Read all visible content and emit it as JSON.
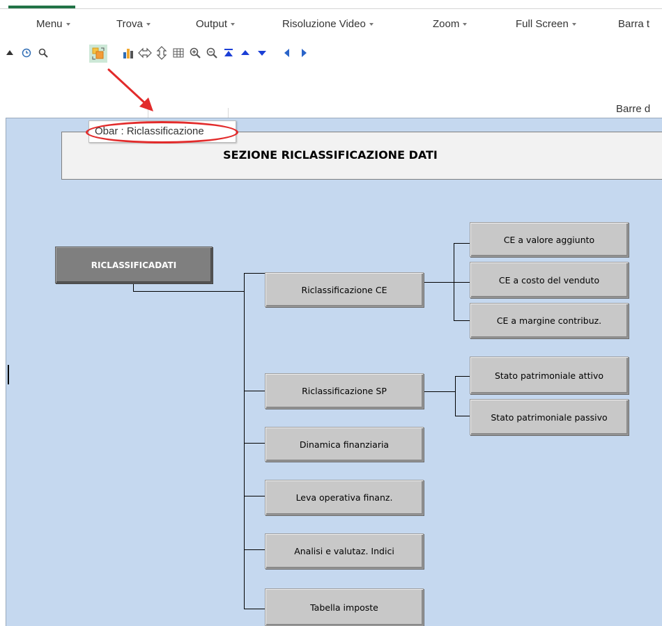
{
  "ribbon": {
    "menus": [
      {
        "label": "Menu"
      },
      {
        "label": "Trova"
      },
      {
        "label": "Output"
      },
      {
        "label": "Risoluzione Video"
      },
      {
        "label": "Zoom"
      },
      {
        "label": "Full Screen"
      },
      {
        "label": "Barra t"
      }
    ],
    "toolbar_icons": [
      "triangle-up-icon",
      "clock-icon",
      "magnifier-icon",
      "objects-icon",
      "bar-chart-icon",
      "expand-horizontal-icon",
      "expand-vertical-icon",
      "table-icon",
      "zoom-in-icon",
      "zoom-out-icon",
      "go-to-top-icon",
      "arrow-up-icon",
      "arrow-down-icon",
      "arrow-left-icon",
      "arrow-right-icon"
    ],
    "group_label": "Barre d"
  },
  "tooltip": {
    "text": "Obar : Riclassificazione"
  },
  "annotation": {
    "color": "#e22b2b"
  },
  "sheet": {
    "section_title": "SEZIONE RICLASSIFICAZIONE DATI",
    "main_button": "RICLASSIFICADATI",
    "level1": [
      {
        "label": "Riclassificazione CE"
      },
      {
        "label": "Riclassificazione SP"
      },
      {
        "label": "Dinamica finanziaria"
      },
      {
        "label": "Leva operativa  finanz."
      },
      {
        "label": "Analisi e valutaz. Indici"
      },
      {
        "label": "Tabella imposte"
      }
    ],
    "ce_children": [
      {
        "label": "CE  a valore aggiunto"
      },
      {
        "label": "CE  a costo del venduto"
      },
      {
        "label": "CE a margine contribuz."
      }
    ],
    "sp_children": [
      {
        "label": "Stato patrimoniale attivo"
      },
      {
        "label": "Stato patrimoniale passivo"
      }
    ]
  },
  "colors": {
    "sheet_background": "#c5d8ef",
    "button_face": "#c8c8c8",
    "main_button_face": "#7f7f7f",
    "excel_green": "#217346"
  }
}
